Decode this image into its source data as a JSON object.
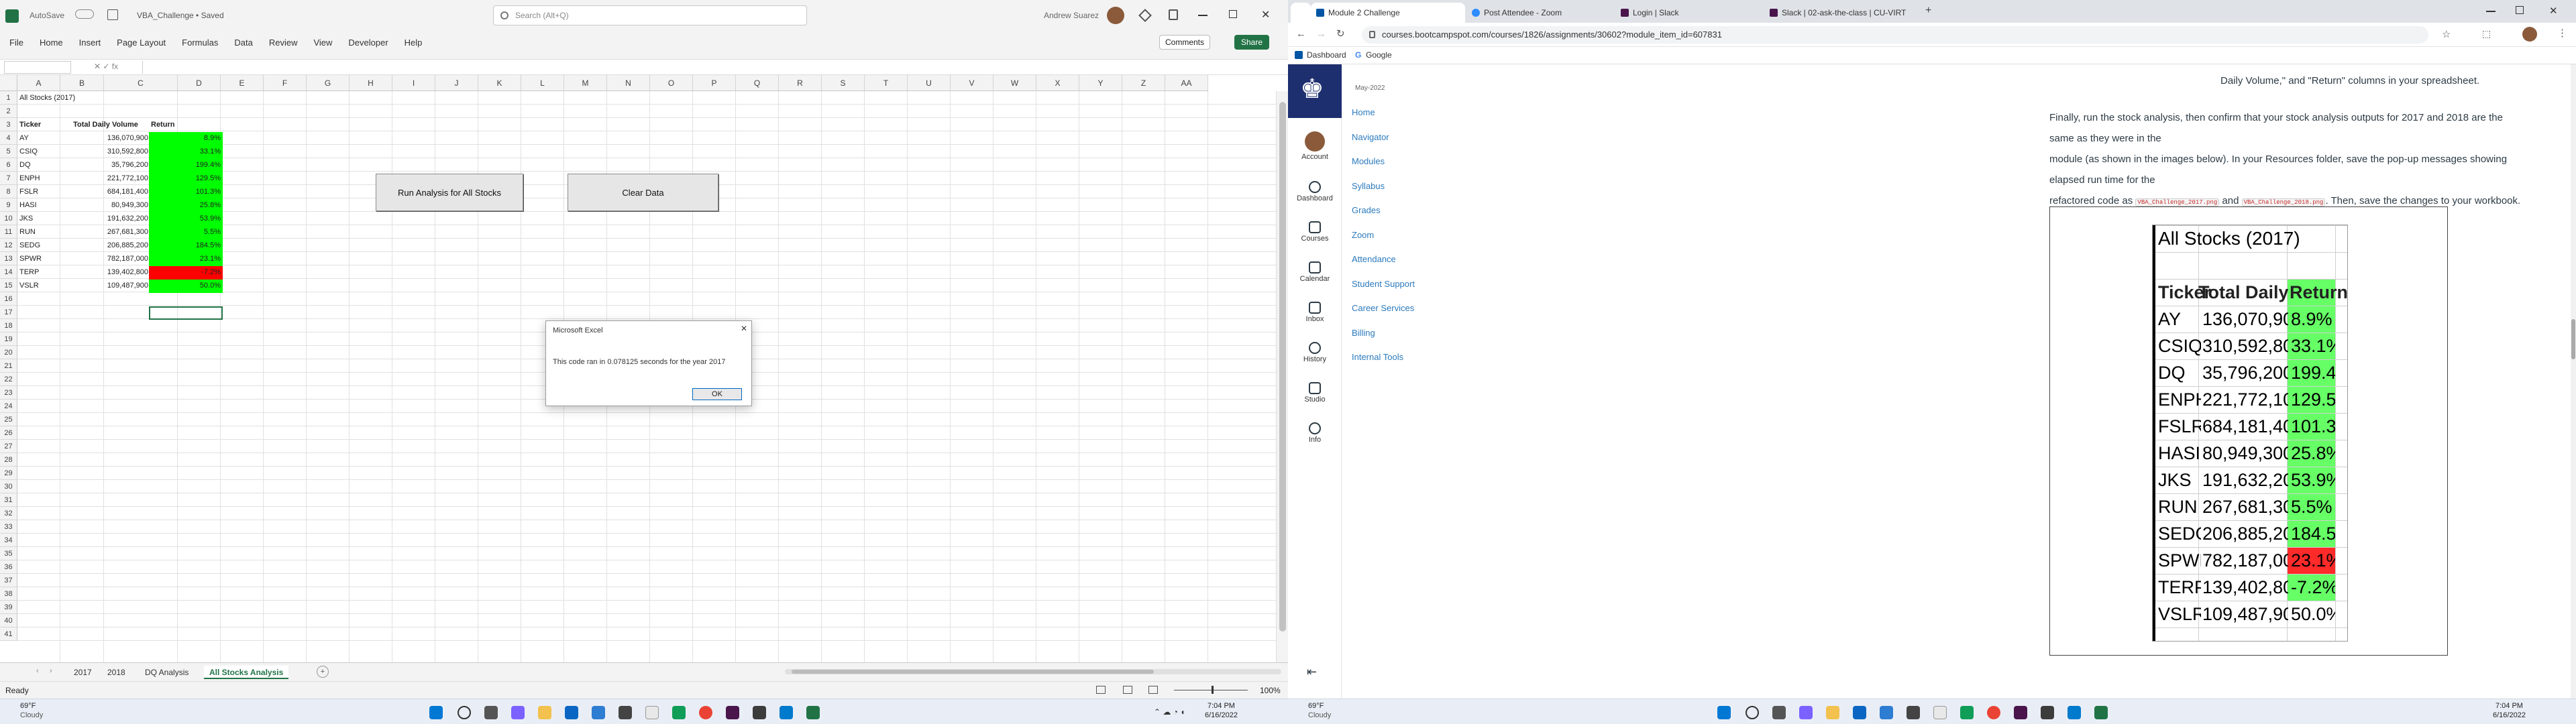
{
  "excel": {
    "autosave": "AutoSave",
    "file_title": "VBA_Challenge • Saved",
    "search_placeholder": "Search (Alt+Q)",
    "user": "Andrew Suarez",
    "menu": [
      "File",
      "Home",
      "Insert",
      "Page Layout",
      "Formulas",
      "Data",
      "Review",
      "View",
      "Developer",
      "Help"
    ],
    "comments": "Comments",
    "share": "Share",
    "name_box": "C17",
    "columns": [
      "A",
      "B",
      "C",
      "D",
      "E",
      "F",
      "G",
      "H",
      "I",
      "J",
      "K",
      "L",
      "M",
      "N",
      "O",
      "P",
      "Q",
      "R",
      "S",
      "T",
      "U",
      "V",
      "W",
      "X",
      "Y",
      "Z",
      "AA"
    ],
    "rows": [
      1,
      2,
      3,
      4,
      5,
      6,
      7,
      8,
      9,
      10,
      11,
      12,
      13,
      14,
      15,
      16,
      17,
      18,
      19,
      20,
      21,
      22,
      23,
      24,
      25,
      26,
      27,
      28,
      29,
      30,
      31,
      32,
      33,
      34,
      35,
      36,
      37,
      38,
      39,
      40,
      41
    ],
    "sheet_title": "All Stocks (2017)",
    "headers": {
      "ticker": "Ticker",
      "volume": "Total Daily Volume",
      "ret": "Return"
    },
    "stocks": [
      {
        "ticker": "AY",
        "volume": "136,070,900",
        "ret": "8.9%",
        "positive": true
      },
      {
        "ticker": "CSIQ",
        "volume": "310,592,800",
        "ret": "33.1%",
        "positive": true
      },
      {
        "ticker": "DQ",
        "volume": "35,796,200",
        "ret": "199.4%",
        "positive": true
      },
      {
        "ticker": "ENPH",
        "volume": "221,772,100",
        "ret": "129.5%",
        "positive": true
      },
      {
        "ticker": "FSLR",
        "volume": "684,181,400",
        "ret": "101.3%",
        "positive": true
      },
      {
        "ticker": "HASI",
        "volume": "80,949,300",
        "ret": "25.8%",
        "positive": true
      },
      {
        "ticker": "JKS",
        "volume": "191,632,200",
        "ret": "53.9%",
        "positive": true
      },
      {
        "ticker": "RUN",
        "volume": "267,681,300",
        "ret": "5.5%",
        "positive": true
      },
      {
        "ticker": "SEDG",
        "volume": "206,885,200",
        "ret": "184.5%",
        "positive": true
      },
      {
        "ticker": "SPWR",
        "volume": "782,187,000",
        "ret": "23.1%",
        "positive": true
      },
      {
        "ticker": "TERP",
        "volume": "139,402,800",
        "ret": "-7.2%",
        "positive": false
      },
      {
        "ticker": "VSLR",
        "volume": "109,487,900",
        "ret": "50.0%",
        "positive": true
      }
    ],
    "btn_run": "Run Analysis for All Stocks",
    "btn_clear": "Clear Data",
    "dialog": {
      "title": "Microsoft Excel",
      "message": "This code ran in 0.078125 seconds for the year 2017",
      "ok": "OK"
    },
    "sheet_tabs": [
      "2017",
      "2018",
      "DQ Analysis",
      "All Stocks Analysis"
    ],
    "active_tab": "All Stocks Analysis",
    "status_ready": "Ready",
    "zoom": "100%"
  },
  "taskbar_left": {
    "weather_temp": "69°F",
    "weather_desc": "Cloudy",
    "time": "7:04 PM",
    "date": "6/16/2022"
  },
  "browser": {
    "tabs": [
      "Module 2 Challenge",
      "Post Attendee - Zoom",
      "Login | Slack",
      "Slack | 02-ask-the-class | CU-VIRT"
    ],
    "url": "courses.bootcampspot.com/courses/1826/assignments/30602?module_item_id=607831",
    "bookmarks": [
      "Dashboard",
      "Google"
    ],
    "course_date": "May-2022",
    "nav": [
      "Account",
      "Dashboard",
      "Courses",
      "Calendar",
      "Inbox",
      "History",
      "Studio",
      "Info"
    ],
    "sub_nav": [
      "Home",
      "Navigator",
      "Modules",
      "Syllabus",
      "Grades",
      "Zoom",
      "Attendance",
      "Student Support",
      "Career Services",
      "Billing",
      "Internal Tools"
    ],
    "top_text": "Daily Volume,\" and \"Return\" columns in your spreadsheet.",
    "para1_a": "Finally, run the stock analysis, then confirm that your stock analysis outputs for 2017 and 2018 are the same as they were in the",
    "para1_b": "module (as shown in the images below). In your Resources folder, save the pop-up messages showing elapsed run time for the",
    "para1_c1": "refactored code as",
    "code1": "VBA_Challenge_2017.png",
    "para1_and": "and",
    "code2": "VBA_Challenge_2018.png",
    "para1_c2": ". Then, save the changes to your workbook."
  },
  "taskbar_right": {
    "weather_temp": "69°F",
    "weather_desc": "Cloudy",
    "time": "7:04 PM",
    "date": "6/16/2022"
  },
  "colors": {
    "green": "#00ff00",
    "red": "#ff0000",
    "img_green": "#66ff66",
    "img_red": "#ff2a2a",
    "excel_green": "#217346"
  }
}
